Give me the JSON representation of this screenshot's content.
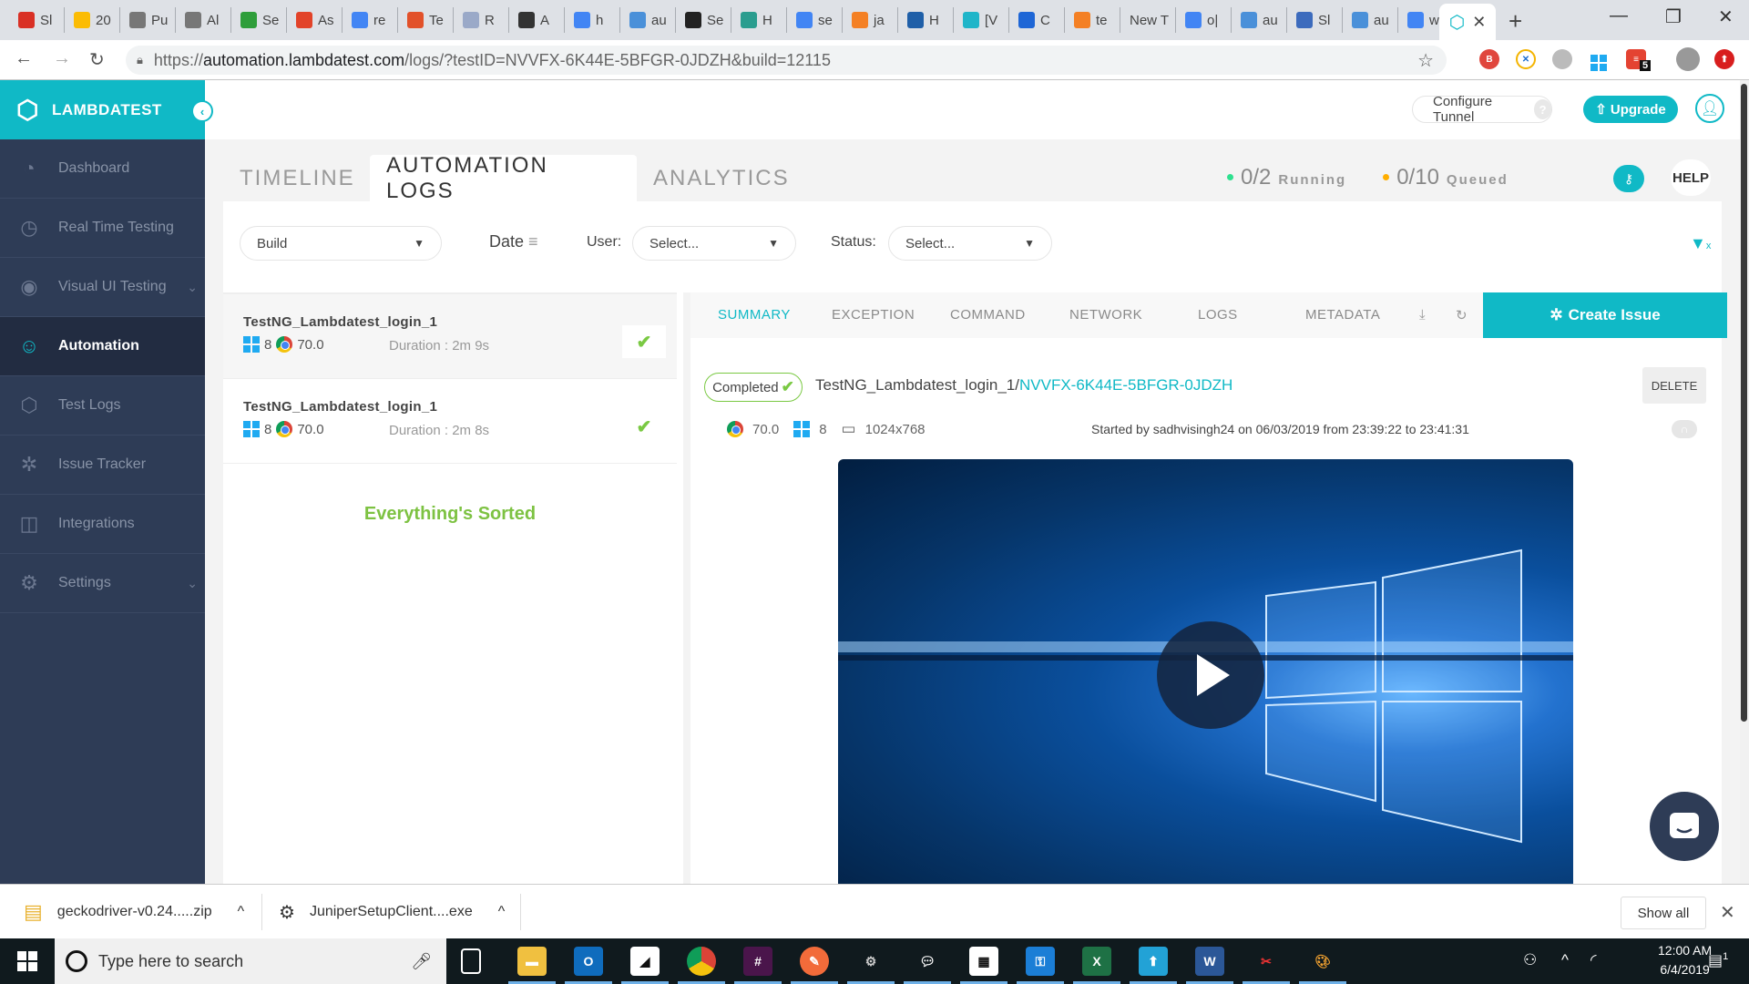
{
  "browser": {
    "tabs": [
      {
        "label": "Sl",
        "icon": "gmail-icon",
        "color": "#d93025"
      },
      {
        "label": "20",
        "icon": "photos-icon",
        "color": "#fbbc04"
      },
      {
        "label": "Pu",
        "icon": "doc-icon",
        "color": "#777"
      },
      {
        "label": "Al",
        "icon": "doc-icon",
        "color": "#777"
      },
      {
        "label": "Se",
        "icon": "terminal-icon",
        "color": "#2e9e3a"
      },
      {
        "label": "As",
        "icon": "gitlab-icon",
        "color": "#e24329"
      },
      {
        "label": "re",
        "icon": "google-icon",
        "color": "#4285f4"
      },
      {
        "label": "Te",
        "icon": "gear-tab-icon",
        "color": "#e2512a"
      },
      {
        "label": "R",
        "icon": "ruler-icon",
        "color": "#9aa9c8"
      },
      {
        "label": "A",
        "icon": "grid-icon",
        "color": "#333"
      },
      {
        "label": "h",
        "icon": "google-icon",
        "color": "#4285f4"
      },
      {
        "label": "au",
        "icon": "qa-icon",
        "color": "#4a90d9"
      },
      {
        "label": "Se",
        "icon": "selenium-icon",
        "color": "#222"
      },
      {
        "label": "H",
        "icon": "crunch-icon",
        "color": "#2a9d8f"
      },
      {
        "label": "se",
        "icon": "google-icon",
        "color": "#4285f4"
      },
      {
        "label": "ja",
        "icon": "stackoverflow-icon",
        "color": "#f48024"
      },
      {
        "label": "H",
        "icon": "e-icon",
        "color": "#1f5fa8"
      },
      {
        "label": "[V",
        "icon": "k-icon",
        "color": "#1fb5c9"
      },
      {
        "label": "C",
        "icon": "classroom-icon",
        "color": "#1e66d6"
      },
      {
        "label": "te",
        "icon": "stackoverflow-icon",
        "color": "#f48024"
      },
      {
        "label": "New T",
        "icon": "",
        "color": ""
      },
      {
        "label": "o|",
        "icon": "google-icon",
        "color": "#4285f4"
      },
      {
        "label": "au",
        "icon": "qa-icon",
        "color": "#4a90d9"
      },
      {
        "label": "Sl",
        "icon": "trophy-icon",
        "color": "#3c6bbd"
      },
      {
        "label": "au",
        "icon": "qa-icon",
        "color": "#4a90d9"
      },
      {
        "label": "w",
        "icon": "google-icon",
        "color": "#4285f4"
      }
    ],
    "active_tab_close": "✕",
    "new_tab": "+",
    "url_scheme": "https://",
    "url_host": "automation.lambdatest.com",
    "url_path": "/logs/?testID=NVVFX-6K44E-5BFGR-0JDZH&build=12115",
    "extension_badge": "5"
  },
  "brand": {
    "name": "LAMBDATEST",
    "accent": "#10b9c6"
  },
  "sidebar": {
    "items": [
      {
        "label": "Dashboard",
        "icon": "dashboard-gauge-icon",
        "glyph": "◔"
      },
      {
        "label": "Real Time Testing",
        "icon": "clock-icon",
        "glyph": "◷"
      },
      {
        "label": "Visual UI Testing",
        "icon": "eye-window-icon",
        "glyph": "◉",
        "chevron": "⌄"
      },
      {
        "label": "Automation",
        "icon": "robot-icon",
        "glyph": "☺",
        "active": true
      },
      {
        "label": "Test Logs",
        "icon": "box-icon",
        "glyph": "⬡"
      },
      {
        "label": "Issue Tracker",
        "icon": "bug-icon",
        "glyph": "✲"
      },
      {
        "label": "Integrations",
        "icon": "integrations-icon",
        "glyph": "◫"
      },
      {
        "label": "Settings",
        "icon": "gear-icon",
        "glyph": "⚙",
        "chevron": "⌄"
      }
    ]
  },
  "header": {
    "configure_tunnel": "Configure Tunnel",
    "tunnel_help": "?",
    "upgrade": "Upgrade",
    "upgrade_icon": "⇧"
  },
  "main_tabs": [
    {
      "label": "TIMELINE"
    },
    {
      "label": "AUTOMATION LOGS",
      "active": true
    },
    {
      "label": "ANALYTICS"
    }
  ],
  "status": {
    "running_value": "0/2",
    "running_label": "Running",
    "running_color": "#2ee08f",
    "queued_value": "0/10",
    "queued_label": "Queued",
    "queued_color": "#ffae00",
    "help": "HELP"
  },
  "filters": {
    "build": "Build",
    "date": "Date",
    "user_label": "User:",
    "user_placeholder": "Select...",
    "status_label": "Status:",
    "status_placeholder": "Select..."
  },
  "tests": [
    {
      "name": "TestNG_Lambdatest_login_1",
      "os_version": "8",
      "browser_version": "70.0",
      "duration": "Duration : 2m 9s",
      "selected": true
    },
    {
      "name": "TestNG_Lambdatest_login_1",
      "os_version": "8",
      "browser_version": "70.0",
      "duration": "Duration : 2m 8s"
    }
  ],
  "list_footer": "Everything's Sorted",
  "detail": {
    "subtabs": [
      "SUMMARY",
      "EXCEPTION",
      "COMMAND",
      "NETWORK",
      "LOGS",
      "METADATA"
    ],
    "active_subtab": "SUMMARY",
    "create_issue": "Create Issue",
    "status_badge": "Completed",
    "test_name": "TestNG_Lambdatest_login_1/",
    "test_id": "NVVFX-6K44E-5BFGR-0JDZH",
    "delete": "DELETE",
    "browser_version": "70.0",
    "os_version": "8",
    "resolution": "1024x768",
    "started_by": "Started by sadhvisingh24 on 06/03/2019 from 23:39:22 to 23:41:31",
    "toggle_label": "∩"
  },
  "downloads": {
    "items": [
      {
        "name": "geckodriver-v0.24.....zip"
      },
      {
        "name": "JuniperSetupClient....exe"
      }
    ],
    "show_all": "Show all",
    "close": "✕"
  },
  "taskbar": {
    "search_placeholder": "Type here to search",
    "time": "12:00 AM",
    "date": "6/4/2019",
    "notification_count": "1"
  }
}
